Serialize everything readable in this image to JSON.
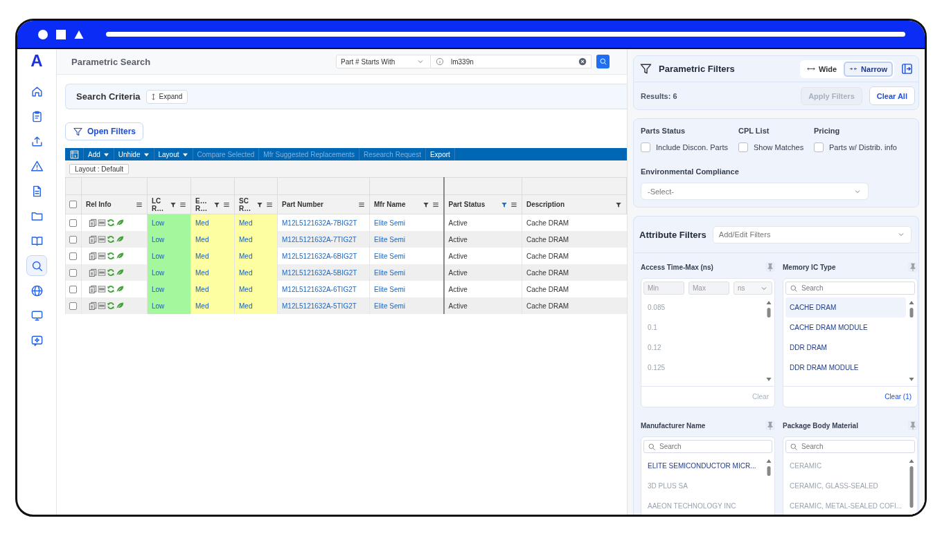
{
  "sidebar": {
    "logo": "A",
    "items": [
      {
        "selected": false
      },
      {
        "selected": false
      },
      {
        "selected": false
      },
      {
        "selected": false
      },
      {
        "selected": false
      },
      {
        "selected": false
      },
      {
        "selected": false
      },
      {
        "selected": true
      },
      {
        "selected": false
      },
      {
        "selected": false
      },
      {
        "selected": false
      }
    ]
  },
  "header": {
    "title": "Parametric Search",
    "search_mode": "Part # Starts With",
    "search_value": "lm339n"
  },
  "search_criteria": {
    "title": "Search Criteria",
    "expand_button": "Expand"
  },
  "open_filters_button": "Open Filters",
  "toolbar": [
    {
      "label": "Add",
      "dropdown": true,
      "disabled": false
    },
    {
      "label": "Unhide",
      "dropdown": true,
      "disabled": false
    },
    {
      "label": "Layout",
      "dropdown": true,
      "disabled": false
    },
    {
      "label": "Compare Selected",
      "dropdown": false,
      "disabled": true
    },
    {
      "label": "Mfr Suggested Replacements",
      "dropdown": false,
      "disabled": true
    },
    {
      "label": "Research Request",
      "dropdown": false,
      "disabled": true
    },
    {
      "label": "Export",
      "dropdown": false,
      "disabled": false
    }
  ],
  "layout_tag": "Layout : Default",
  "table": {
    "header_checked": false,
    "columns": [
      {
        "label": "Rel Info",
        "filter": false,
        "menu": true
      },
      {
        "label": "LC R…",
        "filter": true,
        "filtered": false,
        "menu": true
      },
      {
        "label": "E… R…",
        "filter": true,
        "filtered": false,
        "menu": true
      },
      {
        "label": "SC R…",
        "filter": true,
        "filtered": false,
        "menu": true
      },
      {
        "label": "Part Number",
        "filter": false,
        "menu": true
      },
      {
        "label": "Mfr Name",
        "filter": true,
        "filtered": false,
        "menu": true
      },
      {
        "label": "Part Status",
        "filter": true,
        "filtered": true,
        "menu": true
      },
      {
        "label": "Description",
        "filter": true,
        "filtered": false,
        "menu": false
      }
    ],
    "rows": [
      {
        "checked": false,
        "cells": [
          {
            "kind": "icons"
          },
          {
            "kind": "risk",
            "text": "Low",
            "color": "#a4f79c"
          },
          {
            "kind": "risk",
            "text": "Med",
            "color": "#fdfda2"
          },
          {
            "kind": "risk",
            "text": "Med",
            "color": "#fdfda2"
          },
          {
            "kind": "link",
            "text": "M12L5121632A-7BIG2T"
          },
          {
            "kind": "link",
            "text": "Elite Semi"
          },
          {
            "kind": "plain",
            "text": "Active"
          },
          {
            "kind": "plain",
            "text": "Cache DRAM"
          }
        ]
      },
      {
        "checked": false,
        "cells": [
          {
            "kind": "icons"
          },
          {
            "kind": "risk",
            "text": "Low",
            "color": "#a4f79c"
          },
          {
            "kind": "risk",
            "text": "Med",
            "color": "#fdfda2"
          },
          {
            "kind": "risk",
            "text": "Med",
            "color": "#fdfda2"
          },
          {
            "kind": "link",
            "text": "M12L5121632A-7TIG2T"
          },
          {
            "kind": "link",
            "text": "Elite Semi"
          },
          {
            "kind": "plain",
            "text": "Active"
          },
          {
            "kind": "plain",
            "text": "Cache DRAM"
          }
        ]
      },
      {
        "checked": false,
        "cells": [
          {
            "kind": "icons"
          },
          {
            "kind": "risk",
            "text": "Low",
            "color": "#a4f79c"
          },
          {
            "kind": "risk",
            "text": "Med",
            "color": "#fdfda2"
          },
          {
            "kind": "risk",
            "text": "Med",
            "color": "#fdfda2"
          },
          {
            "kind": "link",
            "text": "M12L5121632A-6BIG2T"
          },
          {
            "kind": "link",
            "text": "Elite Semi"
          },
          {
            "kind": "plain",
            "text": "Active"
          },
          {
            "kind": "plain",
            "text": "Cache DRAM"
          }
        ]
      },
      {
        "checked": false,
        "cells": [
          {
            "kind": "icons"
          },
          {
            "kind": "risk",
            "text": "Low",
            "color": "#a4f79c"
          },
          {
            "kind": "risk",
            "text": "Med",
            "color": "#fdfda2"
          },
          {
            "kind": "risk",
            "text": "Med",
            "color": "#fdfda2"
          },
          {
            "kind": "link",
            "text": "M12L5121632A-5BIG2T"
          },
          {
            "kind": "link",
            "text": "Elite Semi"
          },
          {
            "kind": "plain",
            "text": "Active"
          },
          {
            "kind": "plain",
            "text": "Cache DRAM"
          }
        ]
      },
      {
        "checked": false,
        "cells": [
          {
            "kind": "icons"
          },
          {
            "kind": "risk",
            "text": "Low",
            "color": "#a4f79c"
          },
          {
            "kind": "risk",
            "text": "Med",
            "color": "#fdfda2"
          },
          {
            "kind": "risk",
            "text": "Med",
            "color": "#fdfda2"
          },
          {
            "kind": "link",
            "text": "M12L5121632A-6TIG2T"
          },
          {
            "kind": "link",
            "text": "Elite Semi"
          },
          {
            "kind": "plain",
            "text": "Active"
          },
          {
            "kind": "plain",
            "text": "Cache DRAM"
          }
        ]
      },
      {
        "checked": false,
        "cells": [
          {
            "kind": "icons"
          },
          {
            "kind": "risk",
            "text": "Low",
            "color": "#a4f79c"
          },
          {
            "kind": "risk",
            "text": "Med",
            "color": "#fdfda2"
          },
          {
            "kind": "risk",
            "text": "Med",
            "color": "#fdfda2"
          },
          {
            "kind": "link",
            "text": "M12L5121632A-5TIG2T"
          },
          {
            "kind": "link",
            "text": "Elite Semi"
          },
          {
            "kind": "plain",
            "text": "Active"
          },
          {
            "kind": "plain",
            "text": "Cache DRAM"
          }
        ]
      }
    ]
  },
  "filter_panel": {
    "title": "Parametric Filters",
    "width_modes": [
      {
        "label": "Wide",
        "selected": false
      },
      {
        "label": "Narrow",
        "selected": true
      }
    ],
    "results": "Results: 6",
    "apply_button": {
      "label": "Apply Filters",
      "disabled": true
    },
    "clear_all_button": "Clear All",
    "options": [
      {
        "heading": "Parts Status",
        "label": "Include Discon. Parts",
        "checked": false
      },
      {
        "heading": "CPL List",
        "label": "Show Matches",
        "checked": false
      },
      {
        "heading": "Pricing",
        "label": "Parts w/ Distrib. info",
        "checked": false
      }
    ],
    "environmental": {
      "heading": "Environmental Compliance",
      "placeholder": "-Select-"
    },
    "attribute_filters": {
      "title": "Attribute Filters",
      "placeholder": "Add/Edit Filters"
    },
    "attributes": [
      {
        "kind": "range",
        "title": "Access Time-Max (ns)",
        "min_placeholder": "Min",
        "max_placeholder": "Max",
        "unit": "ns",
        "items": [
          {
            "text": "0.085",
            "disabled": true,
            "selected": false
          },
          {
            "text": "0.1",
            "disabled": true,
            "selected": false
          },
          {
            "text": "0.12",
            "disabled": true,
            "selected": false
          },
          {
            "text": "0.125",
            "disabled": true,
            "selected": false
          }
        ],
        "clear": {
          "label": "Clear",
          "disabled": true
        }
      },
      {
        "kind": "list",
        "title": "Memory IC Type",
        "search_placeholder": "Search",
        "items": [
          {
            "text": "CACHE DRAM",
            "disabled": false,
            "selected": true
          },
          {
            "text": "CACHE DRAM MODULE",
            "disabled": false,
            "selected": false
          },
          {
            "text": "DDR DRAM",
            "disabled": false,
            "selected": false
          },
          {
            "text": "DDR DRAM MODULE",
            "disabled": false,
            "selected": false
          }
        ],
        "clear": {
          "label": "Clear (1)",
          "disabled": false
        }
      },
      {
        "kind": "list",
        "title": "Manufacturer Name",
        "search_placeholder": "Search",
        "items": [
          {
            "text": "ELITE SEMICONDUCTOR MICR...",
            "disabled": false,
            "selected": false
          },
          {
            "text": "3D PLUS SA",
            "disabled": true,
            "selected": false
          },
          {
            "text": "AAEON TECHNOLOGY INC",
            "disabled": true,
            "selected": false
          }
        ]
      },
      {
        "kind": "list",
        "title": "Package Body Material",
        "search_placeholder": "Search",
        "items": [
          {
            "text": "CERAMIC",
            "disabled": true,
            "selected": false
          },
          {
            "text": "CERAMIC, GLASS-SEALED",
            "disabled": true,
            "selected": false
          },
          {
            "text": "CERAMIC, METAL-SEALED COFI...",
            "disabled": true,
            "selected": false
          }
        ]
      }
    ]
  }
}
